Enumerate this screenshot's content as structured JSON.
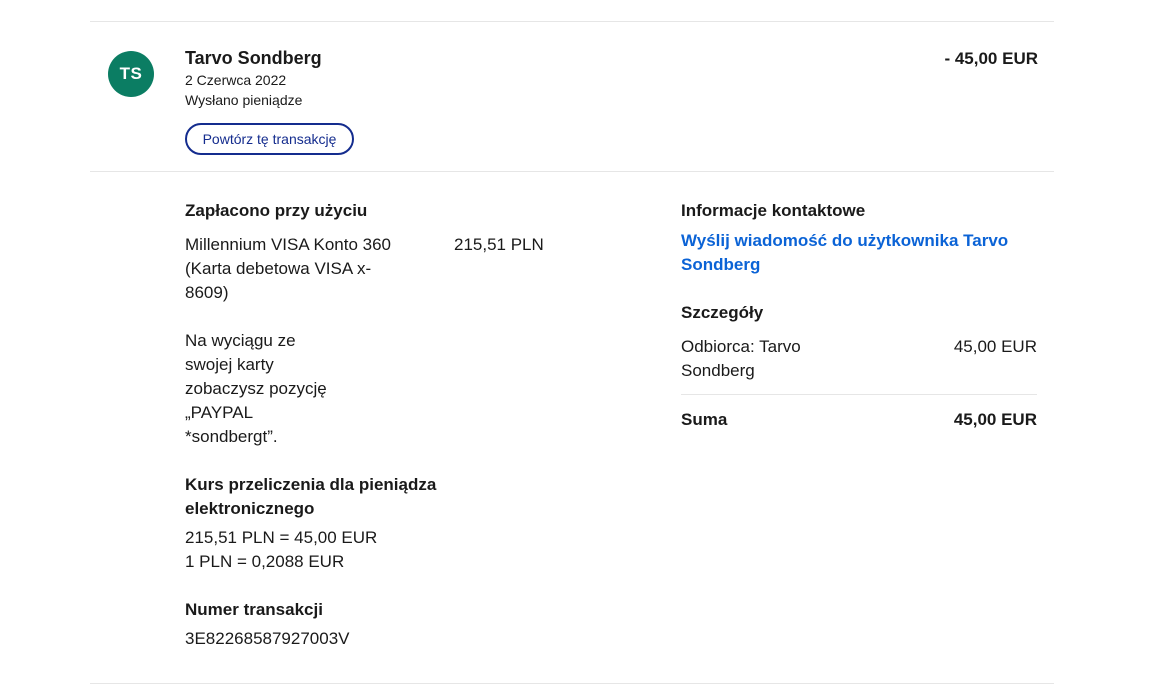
{
  "transaction": {
    "avatar_initials": "TS",
    "counterparty_name": "Tarvo Sondberg",
    "date": "2 Czerwca 2022",
    "type": "Wysłano pieniądze",
    "repeat_button_label": "Powtórz tę transakcję",
    "amount": "- 45,00 EUR"
  },
  "payment": {
    "title": "Zapłacono przy użyciu",
    "method": "Millennium VISA Konto 360 (Karta debetowa VISA x-8609)",
    "statement_note": "Na wyciągu ze swojej karty zobaczysz pozycję „PAYPAL *sondbergt”.",
    "amount": "215,51 PLN"
  },
  "conversion": {
    "title": "Kurs przeliczenia dla pieniądza elektronicznego",
    "line1": "215,51 PLN = 45,00 EUR",
    "line2": "1 PLN = 0,2088 EUR"
  },
  "transaction_id": {
    "title": "Numer transakcji",
    "value": "3E82268587927003V"
  },
  "contact": {
    "title": "Informacje kontaktowe",
    "link": "Wyślij wiadomość do użytkownika Tarvo Sondberg"
  },
  "details": {
    "title": "Szczegóły",
    "recipient_label": "Odbiorca: Tarvo Sondberg",
    "recipient_amount": "45,00 EUR",
    "total_label": "Suma",
    "total_amount": "45,00 EUR"
  },
  "colors": {
    "avatar_bg": "#0b7d63",
    "button_border": "#142c8e",
    "link": "#0b63d6",
    "divider": "#e6e6e6"
  }
}
